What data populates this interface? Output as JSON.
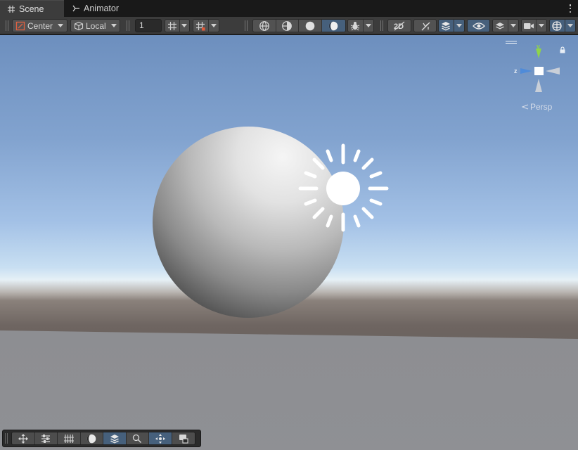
{
  "tabs": [
    {
      "label": "Scene",
      "icon": "grid-icon",
      "active": true
    },
    {
      "label": "Animator",
      "icon": "animator-icon",
      "active": false
    }
  ],
  "toolbar": {
    "pivot_mode": "Center",
    "pivot_rotation": "Local",
    "grid_snap_value": "1"
  },
  "viewport": {
    "projection_label": "Persp",
    "gizmo_axes": {
      "y": "y",
      "z": "z"
    }
  },
  "colors": {
    "toolbar_bg": "#3c3c3c",
    "button_bg": "#525252",
    "active_blue": "#46607c",
    "axis_y": "#8fd44a",
    "axis_z": "#4f8bd9"
  }
}
